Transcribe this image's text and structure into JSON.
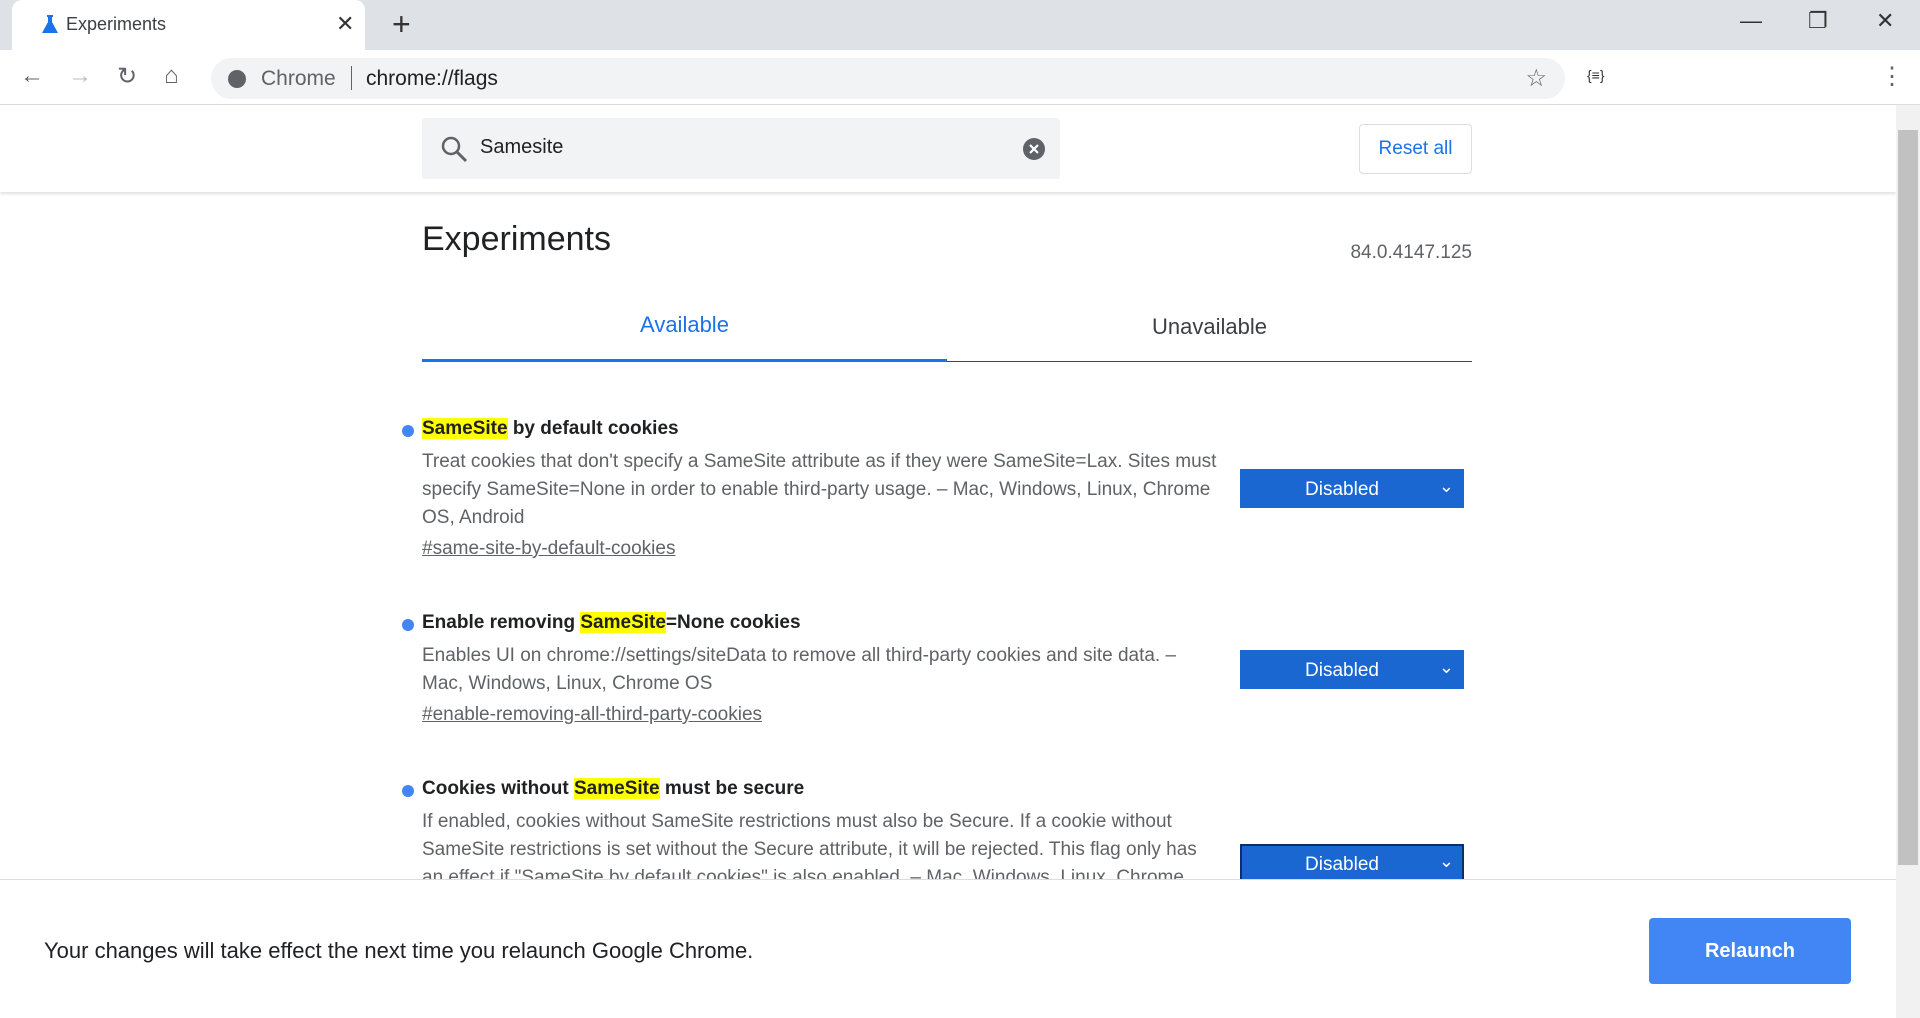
{
  "browser": {
    "tab_title": "Experiments",
    "omnibox_label": "Chrome",
    "url": "chrome://flags"
  },
  "header": {
    "search_value": "Samesite",
    "reset_label": "Reset all"
  },
  "page": {
    "title": "Experiments",
    "version": "84.0.4147.125",
    "tabs": [
      {
        "label": "Available",
        "selected": true
      },
      {
        "label": "Unavailable",
        "selected": false
      }
    ]
  },
  "flags": [
    {
      "title_pre": "",
      "title_hl": "SameSite",
      "title_post": " by default cookies",
      "description": "Treat cookies that don't specify a SameSite attribute as if they were SameSite=Lax. Sites must specify SameSite=None in order to enable third-party usage. – Mac, Windows, Linux, Chrome OS, Android",
      "link": "#same-site-by-default-cookies",
      "value": "Disabled"
    },
    {
      "title_pre": "Enable removing ",
      "title_hl": "SameSite",
      "title_post": "=None cookies",
      "description": "Enables UI on chrome://settings/siteData to remove all third-party cookies and site data. – Mac, Windows, Linux, Chrome OS",
      "link": "#enable-removing-all-third-party-cookies",
      "value": "Disabled"
    },
    {
      "title_pre": "Cookies without ",
      "title_hl": "SameSite",
      "title_post": " must be secure",
      "description": "If enabled, cookies without SameSite restrictions must also be Secure. If a cookie without SameSite restrictions is set without the Secure attribute, it will be rejected. This flag only has an effect if \"SameSite by default cookies\" is also enabled. – Mac, Windows, Linux, Chrome",
      "value": "Disabled"
    }
  ],
  "footer": {
    "message": "Your changes will take effect the next time you relaunch Google Chrome.",
    "relaunch_label": "Relaunch"
  },
  "colors": {
    "accent": "#1a73e8",
    "select": "#1a67d2",
    "highlight": "#ffff00"
  }
}
